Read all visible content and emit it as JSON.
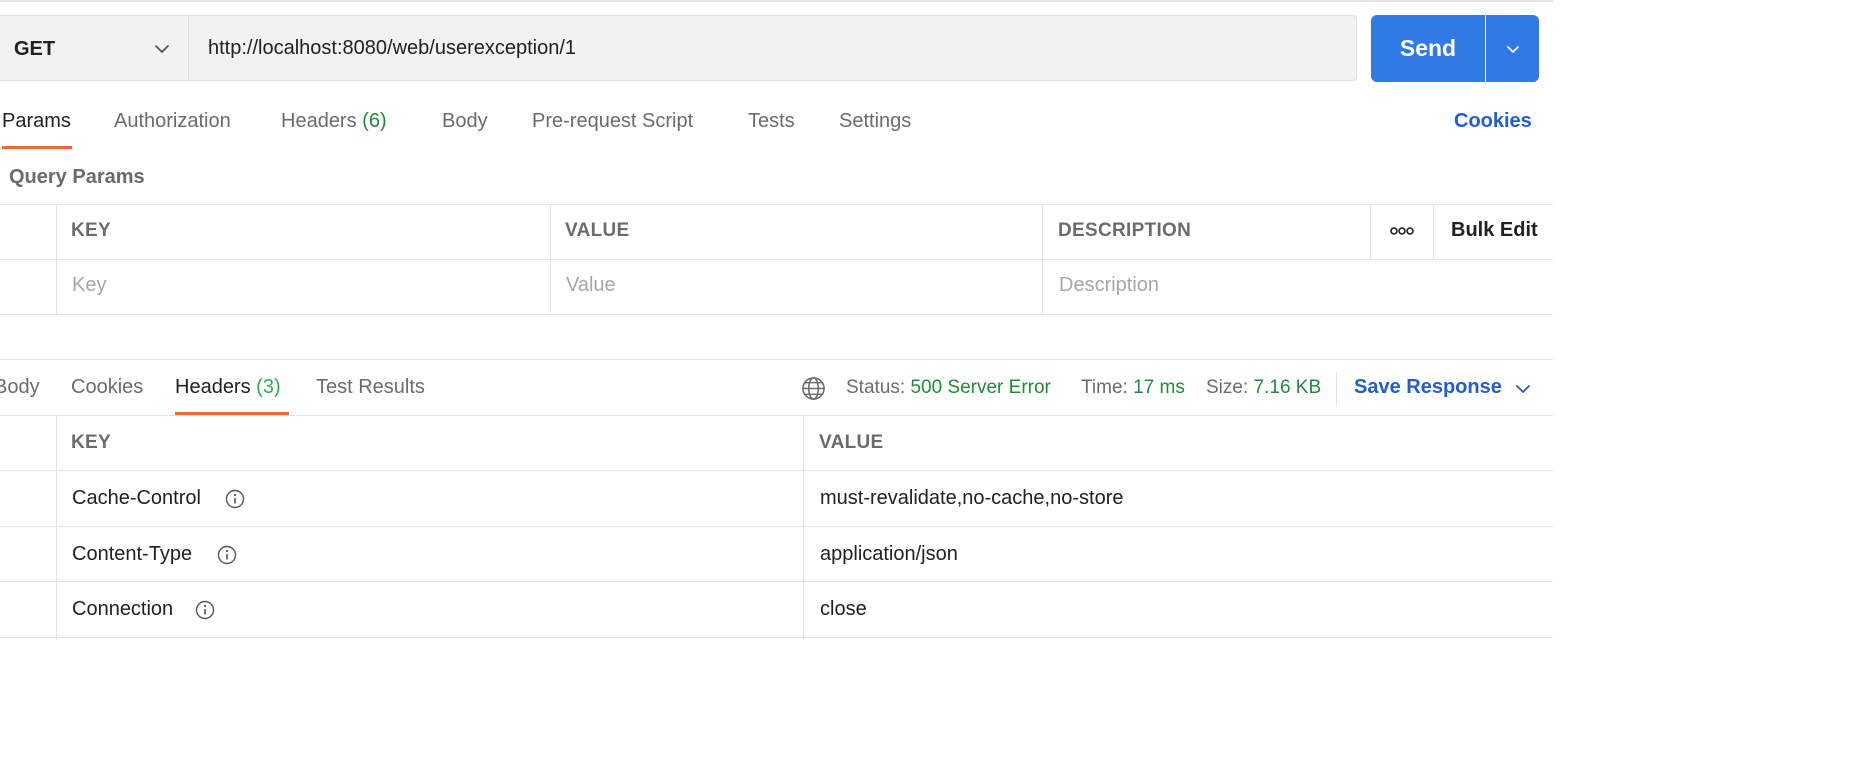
{
  "request": {
    "method": "GET",
    "url": "http://localhost:8080/web/userexception/1",
    "send_label": "Send"
  },
  "request_tabs": [
    {
      "label": "Params",
      "count": ""
    },
    {
      "label": "Authorization",
      "count": ""
    },
    {
      "label": "Headers",
      "count": "(6)"
    },
    {
      "label": "Body",
      "count": ""
    },
    {
      "label": "Pre-request Script",
      "count": ""
    },
    {
      "label": "Tests",
      "count": ""
    },
    {
      "label": "Settings",
      "count": ""
    }
  ],
  "cookies_link": "Cookies",
  "query_params": {
    "title": "Query Params",
    "columns": [
      "KEY",
      "VALUE",
      "DESCRIPTION"
    ],
    "bulk_edit": "Bulk Edit",
    "placeholders": {
      "key": "Key",
      "value": "Value",
      "description": "Description"
    }
  },
  "response_tabs": [
    {
      "label": "Body",
      "count": ""
    },
    {
      "label": "Cookies",
      "count": ""
    },
    {
      "label": "Headers",
      "count": "(3)"
    },
    {
      "label": "Test Results",
      "count": ""
    }
  ],
  "response_meta": {
    "status_label": "Status:",
    "status_value": "500 Server Error",
    "time_label": "Time:",
    "time_value": "17 ms",
    "size_label": "Size:",
    "size_value": "7.16 KB",
    "save_label": "Save Response"
  },
  "response_headers": {
    "columns": [
      "KEY",
      "VALUE"
    ],
    "rows": [
      {
        "key": "Cache-Control",
        "value": "must-revalidate,no-cache,no-store"
      },
      {
        "key": "Content-Type",
        "value": "application/json"
      },
      {
        "key": "Connection",
        "value": "close"
      }
    ]
  },
  "colors": {
    "accent": "#2f7ae5",
    "tab_underline": "#e8693a",
    "status_green": "#1f8a3a",
    "link_blue": "#1f5fd1"
  }
}
